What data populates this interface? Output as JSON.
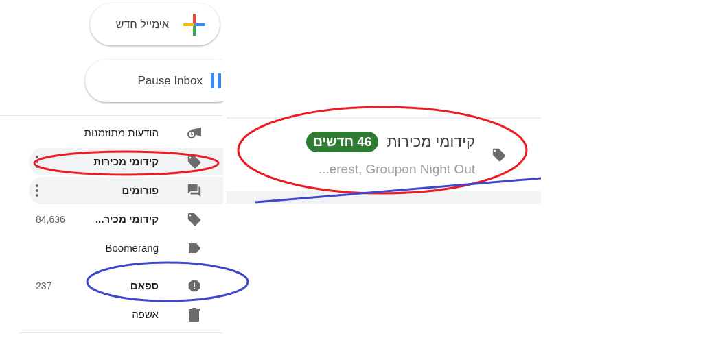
{
  "compose_button": {
    "label": "אימייל חדש"
  },
  "pause_button": {
    "label": "Pause Inbox"
  },
  "sidebar": {
    "items": [
      {
        "kind": "scheduled",
        "label": "הודעות מתוזמנות",
        "bold": false,
        "hovered": false
      },
      {
        "kind": "label",
        "label": "קידומי מכירות",
        "bold": true,
        "hovered": true
      },
      {
        "kind": "forum",
        "label": "פורומים",
        "bold": true,
        "hovered": true
      },
      {
        "kind": "label",
        "label": "קידומי מכיר...",
        "bold": true,
        "hovered": false,
        "count": "84,636"
      },
      {
        "kind": "label_outline",
        "label": "Boomerang",
        "bold": false,
        "hovered": false
      },
      {
        "kind": "spam",
        "label": "ספאם",
        "bold": true,
        "hovered": false,
        "count": "237"
      },
      {
        "kind": "trash",
        "label": "אשפה",
        "bold": false,
        "hovered": false
      }
    ]
  },
  "category_row": {
    "title": "קידומי מכירות",
    "badge": "46 חדשים",
    "snippet": "...erest, Groupon Night Out"
  }
}
